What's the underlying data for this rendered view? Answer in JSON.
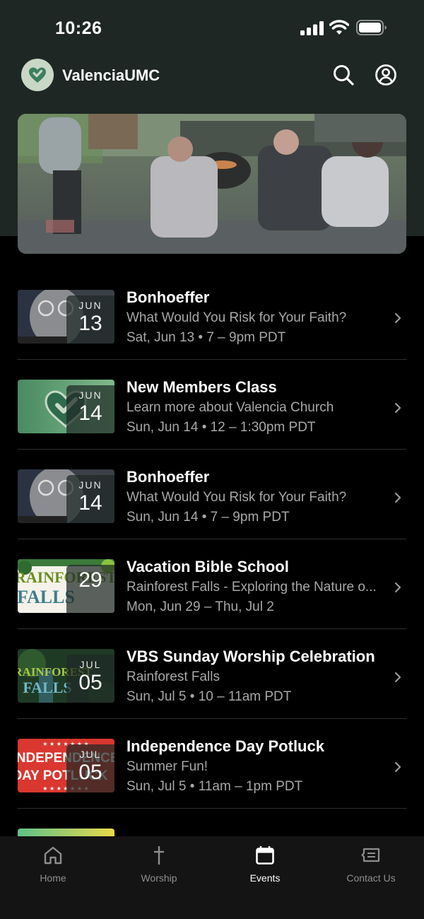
{
  "status_bar": {
    "time": "10:26"
  },
  "header": {
    "app_name": "ValenciaUMC",
    "icons": [
      "heart-logo-icon",
      "search-icon",
      "profile-icon"
    ]
  },
  "hero": {
    "image": "photo of outdoor gathering around fire pit with guitarist"
  },
  "events": [
    {
      "title": "Bonhoeffer",
      "subtitle": "What Would You Risk for Your Faith?",
      "when": "Sat, Jun 13 • 7 – 9pm PDT",
      "month": "JUN",
      "day": "13",
      "thumb": "bonhoeffer"
    },
    {
      "title": "New Members Class",
      "subtitle": "Learn more about Valencia Church",
      "when": "Sun, Jun 14 • 12 – 1:30pm PDT",
      "month": "JUN",
      "day": "14",
      "thumb": "green-heart"
    },
    {
      "title": "Bonhoeffer",
      "subtitle": "What Would You Risk for Your Faith?",
      "when": "Sun, Jun 14 • 7 – 9pm PDT",
      "month": "JUN",
      "day": "14",
      "thumb": "bonhoeffer"
    },
    {
      "title": "Vacation Bible School",
      "subtitle": "Rainforest Falls - Exploring the Nature o...",
      "when": "Mon, Jun 29 – Thu, Jul 2",
      "month": "",
      "day": "29",
      "thumb": "rainforest",
      "thumb_text": [
        "RAINFOREST",
        "FALLS"
      ]
    },
    {
      "title": "VBS Sunday Worship Celebration",
      "subtitle": "Rainforest Falls",
      "when": "Sun, Jul 5 • 10 – 11am PDT",
      "month": "JUL",
      "day": "05",
      "thumb": "rainforest-dark",
      "thumb_text": [
        "RAINFOREST",
        "FALLS"
      ]
    },
    {
      "title": "Independence Day Potluck",
      "subtitle": "Summer Fun!",
      "when": "Sun, Jul 5 • 11am – 1pm PDT",
      "month": "JUL",
      "day": "05",
      "thumb": "independence",
      "thumb_text": [
        "INDEPENDENCE",
        "DAY POTLUCK"
      ]
    }
  ],
  "tabs": [
    {
      "label": "Home",
      "icon": "home-icon",
      "active": false
    },
    {
      "label": "Worship",
      "icon": "cross-icon",
      "active": false
    },
    {
      "label": "Events",
      "icon": "calendar-icon",
      "active": true
    },
    {
      "label": "Contact Us",
      "icon": "message-icon",
      "active": false
    }
  ],
  "colors": {
    "header_bg": "#1e2723",
    "background": "#000000",
    "tab_bar_bg": "#141414",
    "brand_green": "#3f7a5a"
  }
}
